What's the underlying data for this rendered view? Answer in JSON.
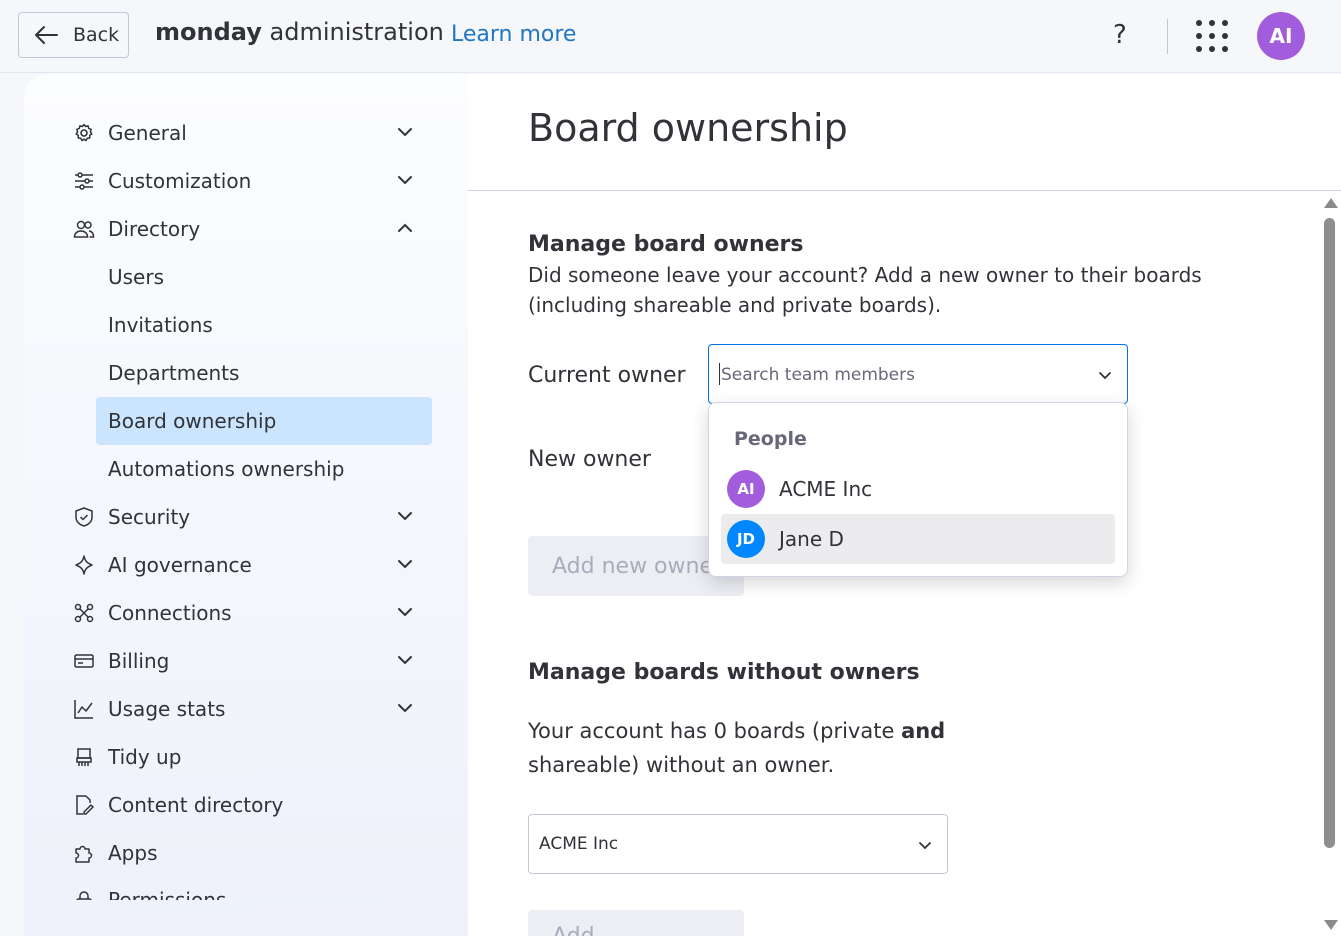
{
  "topbar": {
    "back_label": "Back",
    "brand_bold": "monday",
    "brand_rest": " administration",
    "learn_more": "Learn more",
    "help_symbol": "?",
    "avatar_initials": "AI"
  },
  "sidebar": {
    "general": "General",
    "customization": "Customization",
    "directory": "Directory",
    "directory_items": [
      "Users",
      "Invitations",
      "Departments",
      "Board ownership",
      "Automations ownership"
    ],
    "security": "Security",
    "ai_governance": "AI governance",
    "connections": "Connections",
    "billing": "Billing",
    "usage_stats": "Usage stats",
    "tidy_up": "Tidy up",
    "content_directory": "Content directory",
    "apps": "Apps",
    "permissions": "Permissions"
  },
  "main": {
    "title": "Board ownership",
    "manage_owners": {
      "title": "Manage board owners",
      "description": "Did someone leave your account? Add a new owner to their boards (including shareable and private boards).",
      "current_owner_label": "Current owner",
      "search_placeholder": "Search team members",
      "new_owner_label": "New owner",
      "add_button": "Add new owner"
    },
    "without_owners": {
      "title": "Manage boards without owners",
      "desc_part1": "Your account has 0 boards (private ",
      "desc_bold": "and",
      "desc_part2": " shareable) without an owner.",
      "selected_value": "ACME Inc",
      "add_button": "Add"
    }
  },
  "dropdown": {
    "heading": "People",
    "options": [
      {
        "initials": "AI",
        "name": "ACME Inc",
        "color": "#a25ddc"
      },
      {
        "initials": "JD",
        "name": "Jane D",
        "color": "#0086ff"
      }
    ]
  },
  "colors": {
    "accent": "#0073ea",
    "active_nav": "#cce5ff",
    "link": "#1f76c2"
  }
}
